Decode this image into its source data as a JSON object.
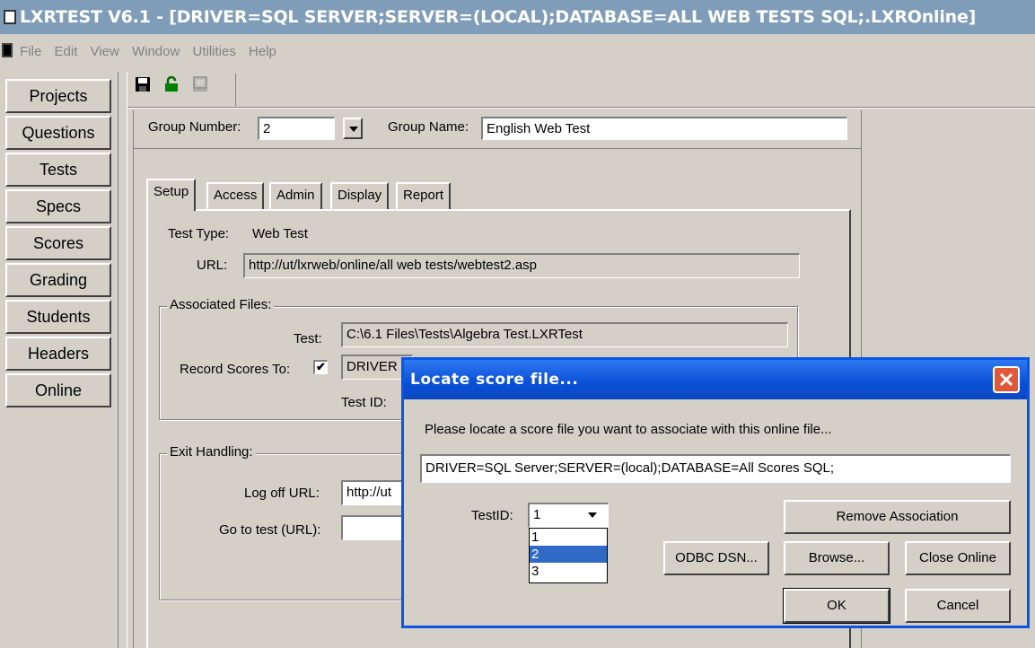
{
  "window": {
    "title": "LXRTEST V6.1 - [DRIVER=SQL SERVER;SERVER=(LOCAL);DATABASE=ALL WEB TESTS SQL;.LXROnline]"
  },
  "menu": [
    "File",
    "Edit",
    "View",
    "Window",
    "Utilities",
    "Help"
  ],
  "toolbar": {
    "icons": [
      "save-icon",
      "unlock-icon",
      "preview-icon"
    ]
  },
  "nav": [
    "Projects",
    "Questions",
    "Tests",
    "Specs",
    "Scores",
    "Grading",
    "Students",
    "Headers",
    "Online"
  ],
  "group": {
    "number_label": "Group Number:",
    "number_value": "2",
    "name_label": "Group Name:",
    "name_value": "English Web Test"
  },
  "tabs": [
    "Setup",
    "Access",
    "Admin",
    "Display",
    "Report"
  ],
  "setup": {
    "test_type_label": "Test Type:",
    "test_type_value": "Web Test",
    "url_label": "URL:",
    "url_value": "http://ut/lxrweb/online/all web tests/webtest2.asp",
    "assoc_title": "Associated Files:",
    "test_label": "Test:",
    "test_value": "C:\\6.1 Files\\Tests\\Algebra Test.LXRTest",
    "record_label": "Record Scores To:",
    "record_checked": "✔",
    "record_value": "DRIVER",
    "testid_label": "Test ID:",
    "exit_title": "Exit Handling:",
    "logoff_label": "Log off URL:",
    "logoff_value": "http://ut",
    "goto_label": "Go to test (URL):",
    "goto_value": ""
  },
  "dialog": {
    "title": "Locate score file...",
    "prompt": "Please locate a score file you want to associate with this online file...",
    "connection": "DRIVER=SQL Server;SERVER=(local);DATABASE=All Scores SQL;",
    "testid_label": "TestID:",
    "testid_value": "1",
    "testid_options": [
      "1",
      "2",
      "3"
    ],
    "testid_selected": "2",
    "remove_label": "Remove Association",
    "odbc_label": "ODBC DSN...",
    "browse_label": "Browse...",
    "close_online_label": "Close Online",
    "ok_label": "OK",
    "cancel_label": "Cancel"
  },
  "colors": {
    "title_bar": "#7f9db9",
    "dialog_title": "#0a4fd6",
    "selection": "#316ac5",
    "face": "#d4d0c8"
  }
}
